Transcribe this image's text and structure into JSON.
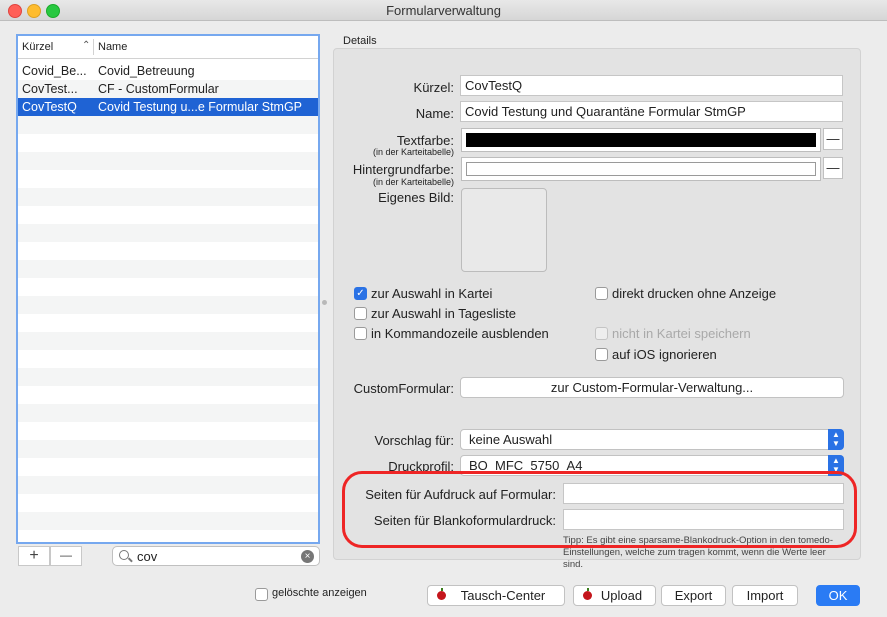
{
  "window": {
    "title": "Formularverwaltung"
  },
  "list": {
    "col_kuerzel": "Kürzel",
    "col_name": "Name",
    "rows": [
      {
        "kuerzel": "Covid_Be...",
        "name": "Covid_Betreuung",
        "selected": false
      },
      {
        "kuerzel": "CovTest...",
        "name": "CF - CustomFormular",
        "selected": false
      },
      {
        "kuerzel": "CovTestQ",
        "name": "Covid Testung u...e Formular StmGP",
        "selected": true
      }
    ],
    "add_label": "+",
    "remove_label": "—",
    "search_value": "cov",
    "clear_label": "×"
  },
  "details": {
    "group_label": "Details",
    "kuerzel_label": "Kürzel:",
    "kuerzel_value": "CovTestQ",
    "name_label": "Name:",
    "name_value": "Covid Testung und Quarantäne Formular StmGP",
    "textfarbe_label": "Textfarbe:",
    "textfarbe_sub": "(in der Karteitabelle)",
    "hintergrund_label": "Hintergrundfarbe:",
    "hintergrund_sub": "(in der Karteitabelle)",
    "minus_label": "—",
    "bild_label": "Eigenes Bild:",
    "textfarbe_color": "#000000",
    "hintergrund_color": "#ffffff",
    "checkboxes": {
      "kartei": {
        "label": "zur Auswahl in Kartei",
        "checked": true
      },
      "tagesliste": {
        "label": "zur Auswahl in Tagesliste",
        "checked": false
      },
      "kommando": {
        "label": "in Kommandozeile ausblenden",
        "checked": false
      },
      "direkt": {
        "label": "direkt drucken ohne Anzeige",
        "checked": false
      },
      "nicht_speichern": {
        "label": "nicht in Kartei speichern",
        "checked": false,
        "disabled": true
      },
      "ios": {
        "label": "auf iOS ignorieren",
        "checked": false
      }
    },
    "customformular_label": "CustomFormular:",
    "customformular_button": "zur Custom-Formular-Verwaltung...",
    "vorschlag_label": "Vorschlag für:",
    "vorschlag_value": "keine Auswahl",
    "druckprofil_label": "Druckprofil:",
    "druckprofil_value": "BO_MFC_5750_A4",
    "aufdruck_label": "Seiten für Aufdruck auf Formular:",
    "aufdruck_value": "",
    "blanko_label": "Seiten für Blankoformulardruck:",
    "blanko_value": "",
    "tipp_text": "Tipp: Es gibt eine sparsame-Blankodruck-Option in den tomedo-Einstellungen, welche zum tragen kommt, wenn die Werte leer sind."
  },
  "footer": {
    "geloeschte_label": "gelöschte anzeigen",
    "tausch_label": "Tausch-Center",
    "upload_label": "Upload",
    "export_label": "Export",
    "import_label": "Import",
    "ok_label": "OK"
  },
  "colors": {
    "accent": "#2a72e5",
    "selection": "#1f63d4",
    "highlight_ring": "#ee2525"
  }
}
